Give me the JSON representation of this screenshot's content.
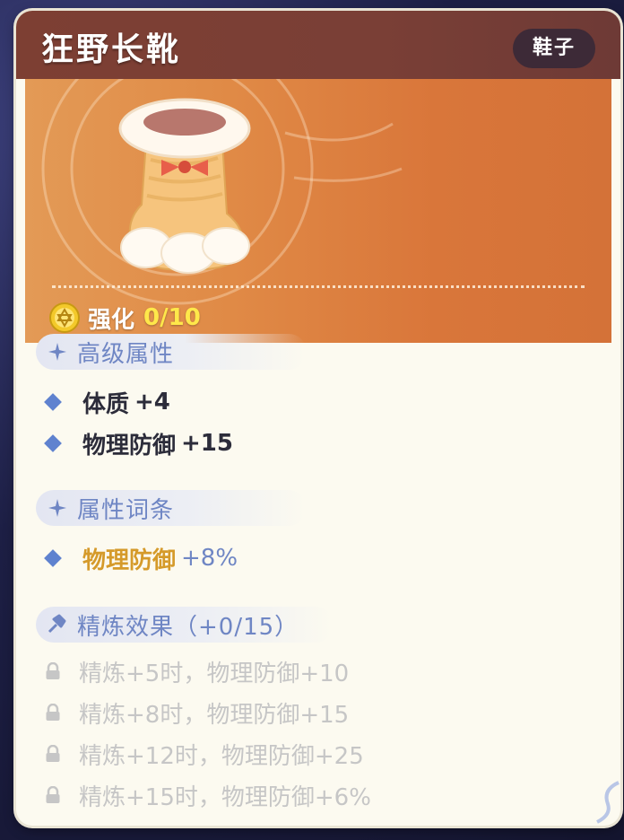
{
  "item": {
    "name": "狂野长靴",
    "type_badge": "鞋子"
  },
  "enhance": {
    "label": "强化",
    "value": "0/10"
  },
  "sections": {
    "advanced": {
      "title": "高级属性",
      "stats": [
        {
          "label": "体质",
          "value": "+4"
        },
        {
          "label": "物理防御",
          "value": "+15"
        }
      ]
    },
    "affix": {
      "title": "属性词条",
      "stats": [
        {
          "label": "物理防御",
          "value": "+8%"
        }
      ]
    },
    "refine": {
      "title": "精炼效果（+0/15）",
      "effects": [
        "精炼+5时，物理防御+10",
        "精炼+8时，物理防御+15",
        "精炼+12时，物理防御+25",
        "精炼+15时，物理防御+6%"
      ]
    }
  },
  "colors": {
    "header_bg": "#7d3f33",
    "hero_bg": "#e08a46",
    "accent_blue": "#6f86c4",
    "affix_gold": "#d59a2a",
    "enhance_value": "#ffe84a",
    "locked_text": "#c6c6c6"
  },
  "icons": {
    "coin": "star-of-david-coin-icon",
    "section": "sparkle-icon",
    "refine": "hammer-icon",
    "lock": "lock-icon",
    "bullet": "diamond-icon"
  }
}
